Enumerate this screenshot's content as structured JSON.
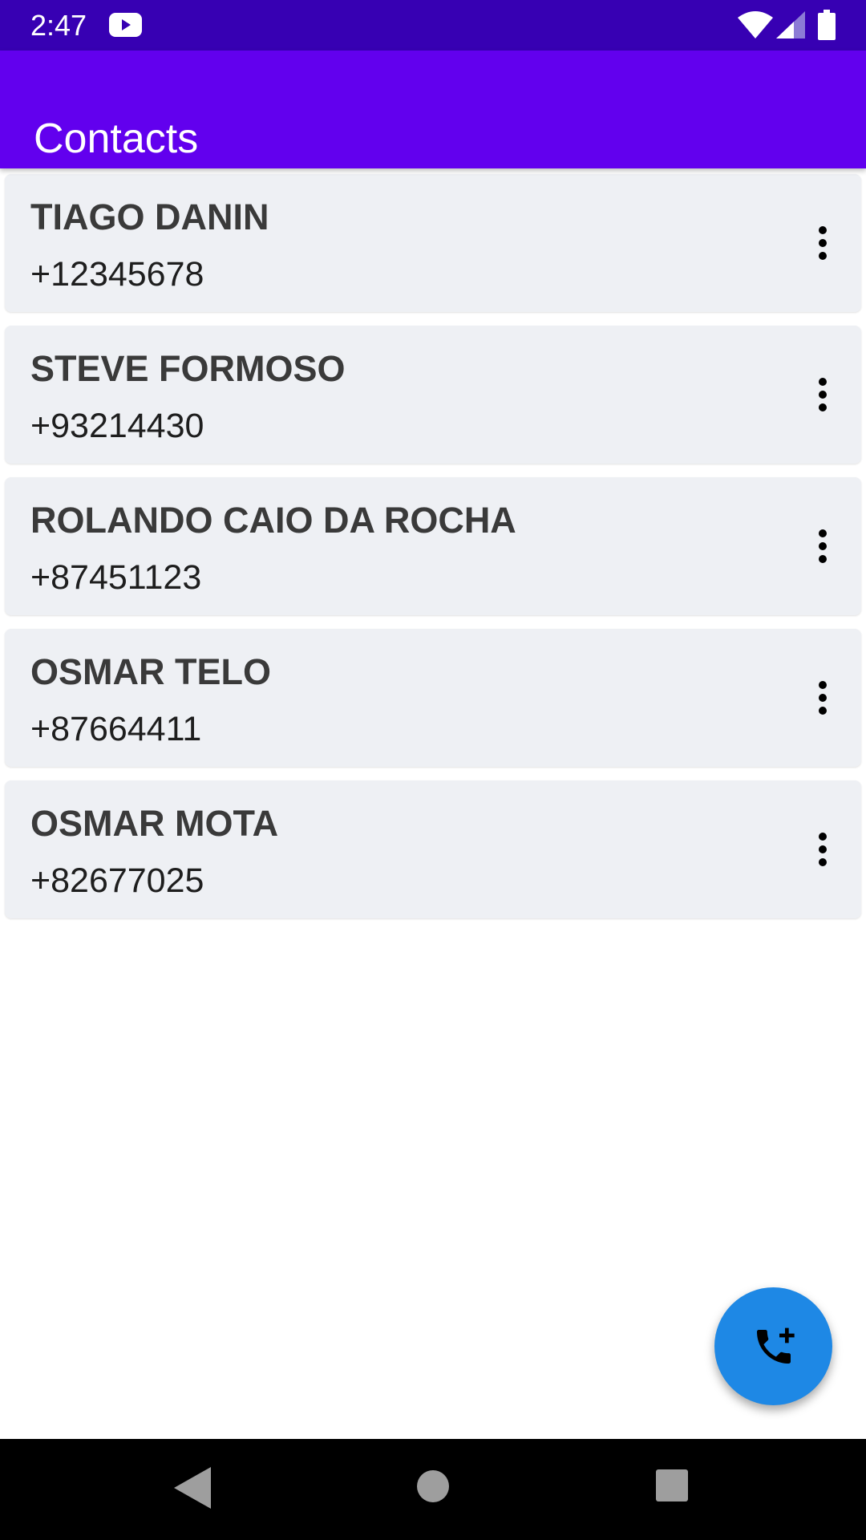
{
  "status_bar": {
    "time": "2:47",
    "icons": [
      "youtube-icon",
      "wifi-icon",
      "cell-signal-icon",
      "battery-icon"
    ]
  },
  "app_bar": {
    "title": "Contacts"
  },
  "contacts": [
    {
      "name": "TIAGO DANIN",
      "phone": "+12345678"
    },
    {
      "name": "STEVE FORMOSO",
      "phone": "+93214430"
    },
    {
      "name": "ROLANDO CAIO DA ROCHA",
      "phone": "+87451123"
    },
    {
      "name": "OSMAR TELO",
      "phone": "+87664411"
    },
    {
      "name": "OSMAR MOTA",
      "phone": "+82677025"
    }
  ],
  "fab": {
    "icon": "add-call-icon"
  },
  "nav_bar": {
    "icons": [
      "back-icon",
      "home-icon",
      "recents-icon"
    ]
  },
  "colors": {
    "status_bar": "#3700b3",
    "app_bar": "#6200ee",
    "card_background": "#eef0f4",
    "fab": "#1e88e5"
  }
}
